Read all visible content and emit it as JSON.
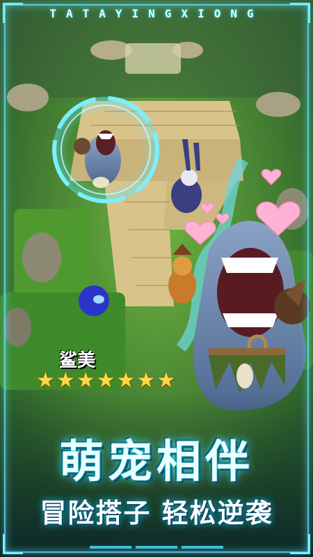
{
  "banner": {
    "brand": "TATAYINGXIONG",
    "tagline_main": "萌宠相伴",
    "tagline_sub": "冒险搭子 轻松逆袭"
  },
  "character": {
    "name": "鲨美",
    "rating_stars": 7,
    "rating_max": 7
  },
  "colors": {
    "frame_glow": "#6ff1ff",
    "star": "#ffd84a",
    "grass": "#4f9a3a",
    "path": "#d8c48a",
    "shark_body": "#6e86a8",
    "heart": "#ffb3d4"
  }
}
